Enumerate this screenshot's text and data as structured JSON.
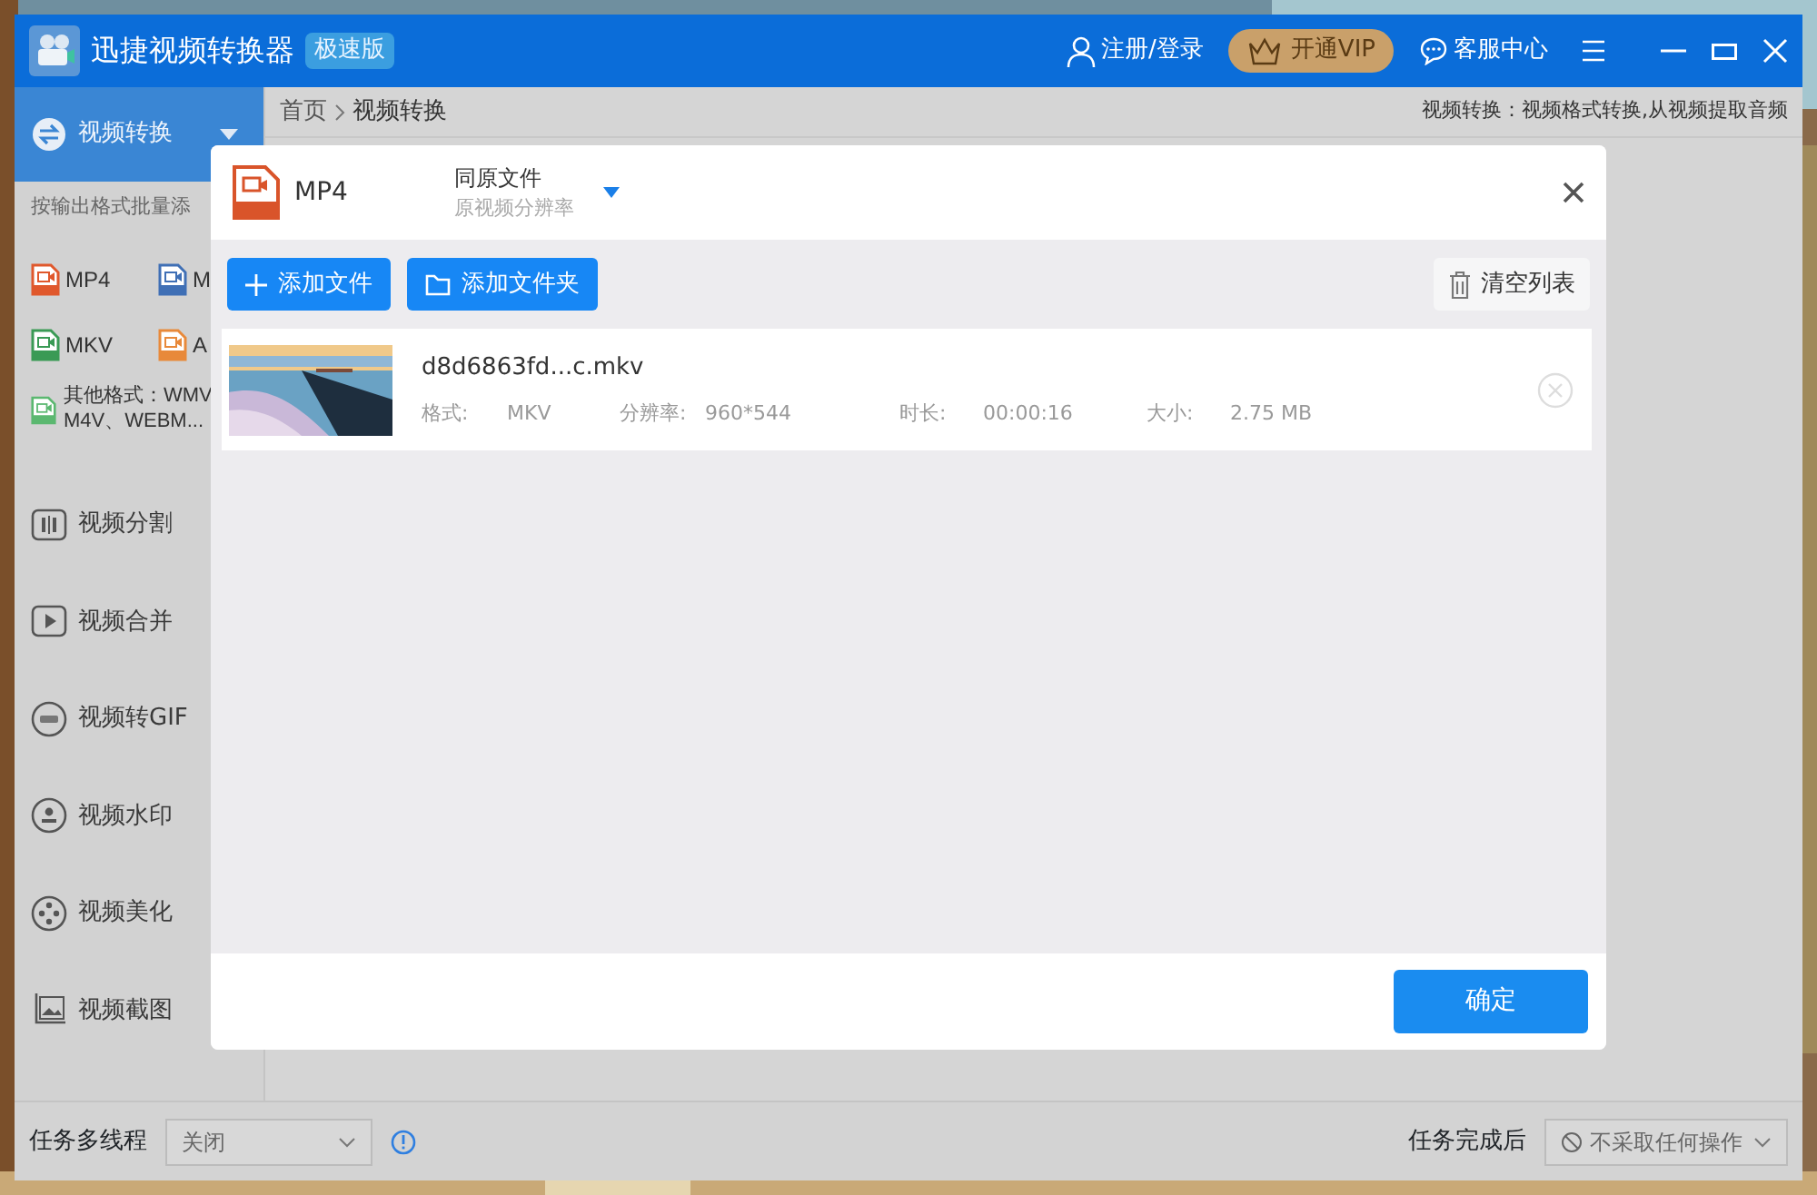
{
  "window": {
    "title": "迅捷视频转换器",
    "edition_badge": "极速版"
  },
  "header": {
    "account": "注册/登录",
    "vip_button": "开通VIP",
    "support": "客服中心"
  },
  "sidebar": {
    "items": [
      {
        "label": "视频转换",
        "selected": true,
        "expanded": true
      },
      {
        "label": "视频分割",
        "selected": false
      },
      {
        "label": "视频合并",
        "selected": false
      },
      {
        "label": "视频转GIF",
        "selected": false
      },
      {
        "label": "视频水印",
        "selected": false
      },
      {
        "label": "视频美化",
        "selected": false
      },
      {
        "label": "视频截图",
        "selected": false
      }
    ],
    "format_hint": "按输出格式批量添",
    "formats": [
      {
        "label": "MP4",
        "color": "#e0582c"
      },
      {
        "label": "M",
        "color": "#3f6fb5"
      },
      {
        "label": "MKV",
        "color": "#3a9a55"
      },
      {
        "label": "A",
        "color": "#e8893a"
      }
    ],
    "other_formats": {
      "lines": [
        "其他格式：WMV",
        "M4V、WEBM..."
      ],
      "color": "#5bb870"
    }
  },
  "breadcrumb": [
    "首页",
    "视频转换"
  ],
  "description": "视频转换：视频格式转换,从视频提取音频",
  "dialog": {
    "output_format": "MP4",
    "quality": {
      "title": "同原文件",
      "subtitle": "原视频分辨率"
    },
    "add_file": "添加文件",
    "add_folder": "添加文件夹",
    "clear": "清空列表",
    "files": [
      {
        "name": "d8d6863fd...c.mkv",
        "fields": [
          {
            "label": "格式:",
            "value": "MKV"
          },
          {
            "label": "分辨率:",
            "value": "960*544"
          },
          {
            "label": "时长:",
            "value": "00:00:16"
          },
          {
            "label": "大小:",
            "value": "2.75 MB"
          }
        ]
      }
    ],
    "confirm": "确定"
  },
  "footer": {
    "multithread": {
      "label": "任务多线程",
      "value": "关闭"
    },
    "after_done": {
      "label": "任务完成后",
      "value": "不采取任何操作"
    }
  }
}
